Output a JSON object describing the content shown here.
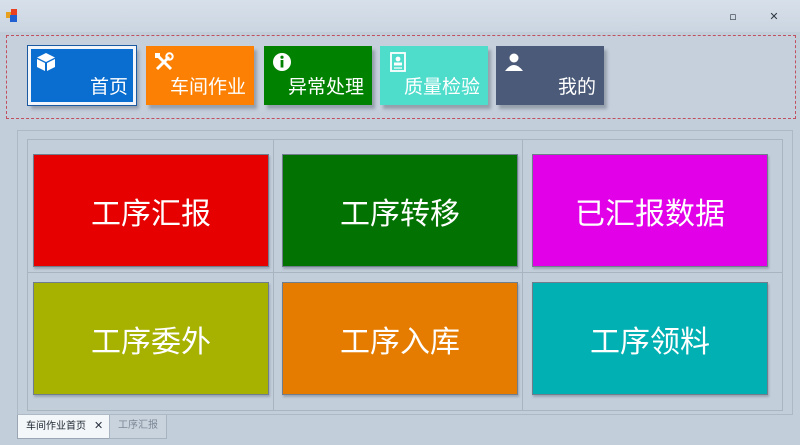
{
  "window": {
    "restore_glyph": "▫",
    "close_glyph": "✕"
  },
  "nav": {
    "items": [
      {
        "label": "首页",
        "color": "#0a6ed0",
        "icon": "cube-icon"
      },
      {
        "label": "车间作业",
        "color": "#fb8004",
        "icon": "tools-icon"
      },
      {
        "label": "异常处理",
        "color": "#008200",
        "icon": "info-icon"
      },
      {
        "label": "质量检验",
        "color": "#4edccb",
        "icon": "id-card-icon"
      },
      {
        "label": "我的",
        "color": "#4b5a78",
        "icon": "user-icon"
      }
    ]
  },
  "tiles": [
    {
      "label": "工序汇报",
      "color": "#e60000"
    },
    {
      "label": "工序转移",
      "color": "#027202"
    },
    {
      "label": "已汇报数据",
      "color": "#e100e8"
    },
    {
      "label": "工序委外",
      "color": "#a7b100"
    },
    {
      "label": "工序入库",
      "color": "#e57c00"
    },
    {
      "label": "工序领料",
      "color": "#01b0b3"
    }
  ],
  "tabs": [
    {
      "label": "车间作业首页",
      "close_glyph": "✕"
    },
    {
      "label": "工序汇报"
    }
  ]
}
